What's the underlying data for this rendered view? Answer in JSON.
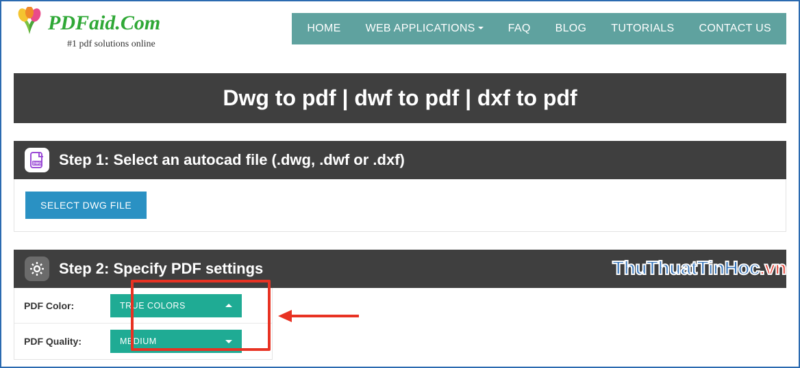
{
  "brand": {
    "name": "PDFaid.Com",
    "tagline": "#1 pdf solutions online"
  },
  "nav": {
    "home": "HOME",
    "webapps": "WEB APPLICATIONS",
    "faq": "FAQ",
    "blog": "BLOG",
    "tutorials": "TUTORIALS",
    "contact": "CONTACT US"
  },
  "hero": {
    "title": "Dwg to pdf | dwf to pdf | dxf to pdf"
  },
  "step1": {
    "title": "Step 1: Select an autocad file (.dwg, .dwf or .dxf)",
    "button": "SELECT DWG FILE"
  },
  "step2": {
    "title": "Step 2: Specify PDF settings",
    "color_label": "PDF Color:",
    "color_value": "TRUE COLORS",
    "quality_label": "PDF Quality:",
    "quality_value": "MEDIUM"
  },
  "watermark": {
    "part1": "ThuThuatTinHoc",
    "part2": ".vn"
  }
}
